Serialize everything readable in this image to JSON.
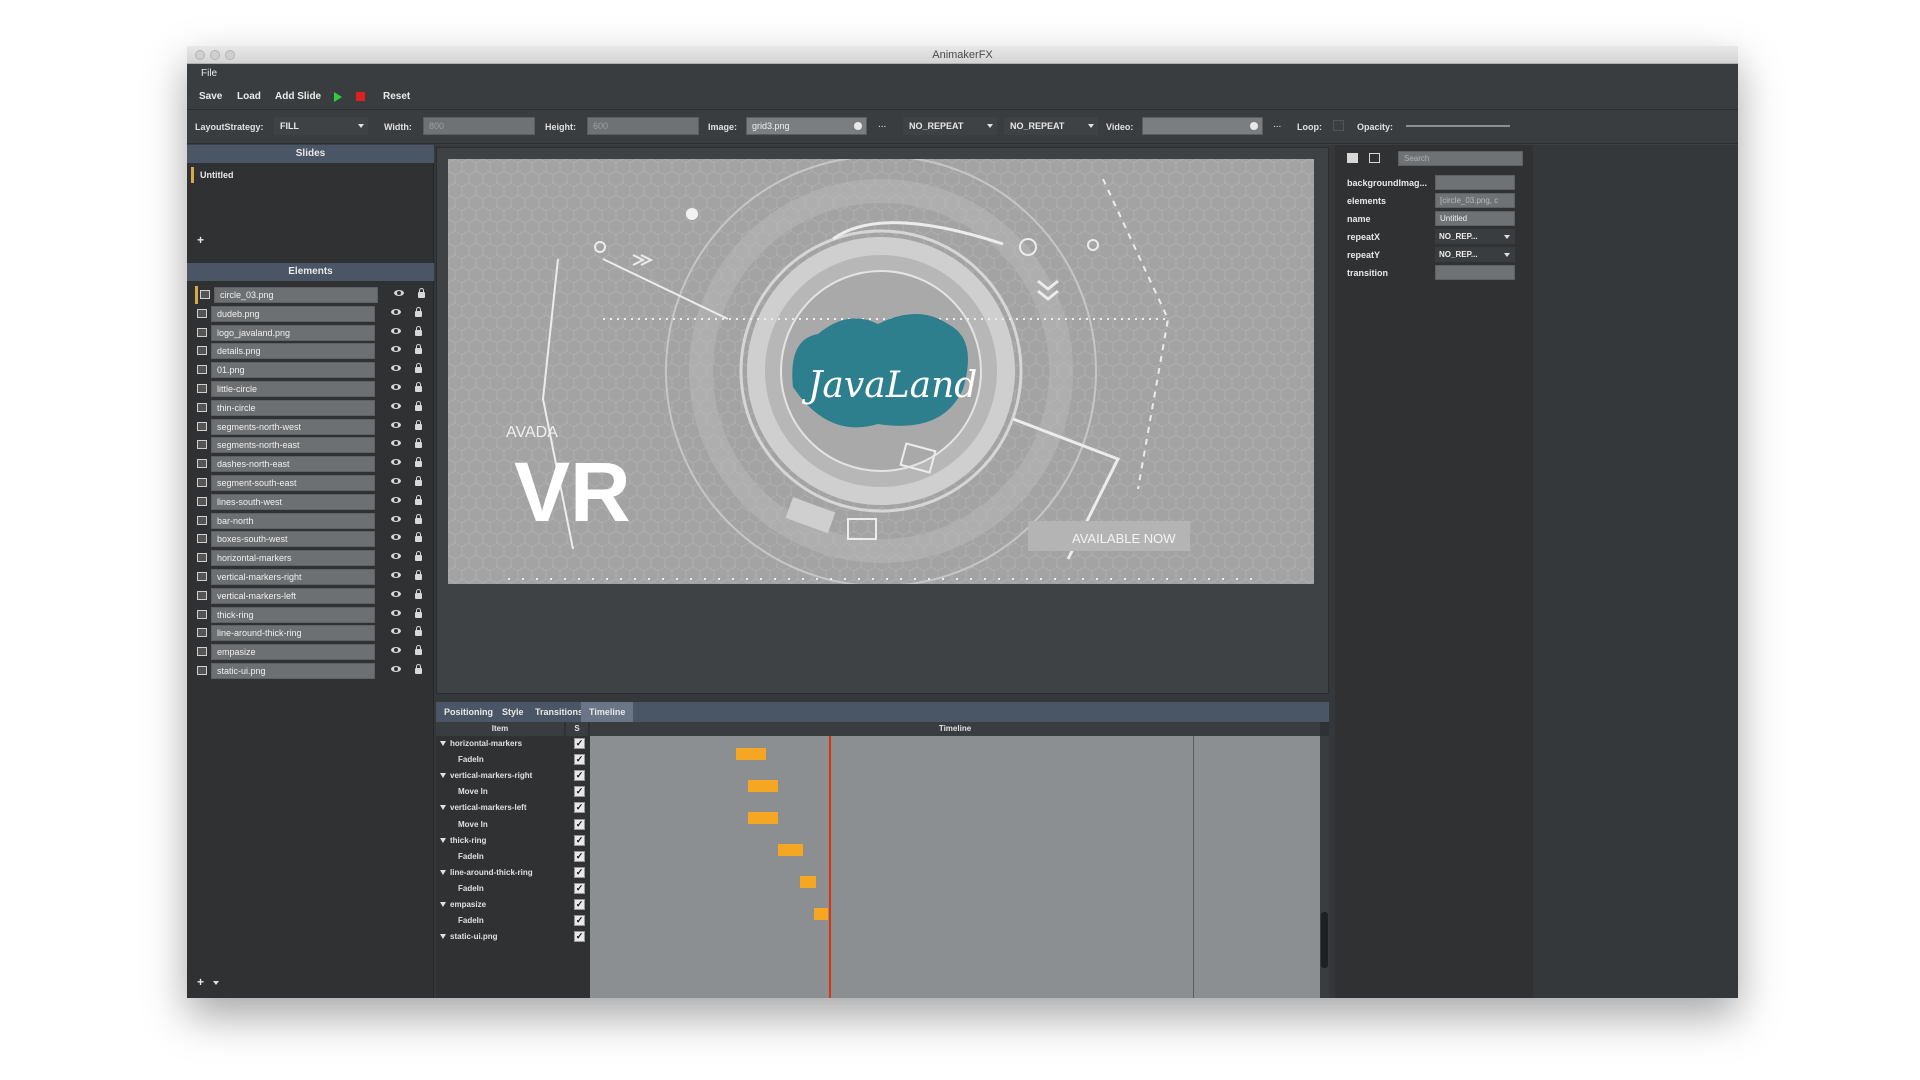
{
  "window": {
    "title": "AnimakerFX"
  },
  "menu": {
    "file": "File"
  },
  "toolbar": {
    "save": "Save",
    "load": "Load",
    "add_slide": "Add Slide",
    "reset": "Reset",
    "colors": {
      "play": "#2ecc40",
      "stop": "#e02020"
    }
  },
  "props_bar": {
    "layout_label": "LayoutStrategy:",
    "layout_value": "FILL",
    "width_label": "Width:",
    "width_value": "800",
    "height_label": "Height:",
    "height_value": "600",
    "image_label": "Image:",
    "image_value": "grid3.png",
    "image_more": "...",
    "repeat_x": "NO_REPEAT",
    "repeat_y": "NO_REPEAT",
    "video_label": "Video:",
    "video_value": "",
    "video_more": "...",
    "loop_label": "Loop:",
    "opacity_label": "Opacity:"
  },
  "slides_panel": {
    "header": "Slides",
    "items": [
      "Untitled"
    ],
    "add": "+"
  },
  "elements_panel": {
    "header": "Elements",
    "items": [
      "circle_03.png",
      "dudeb.png",
      "logo_javaland.png",
      "details.png",
      "01.png",
      "little-circle",
      "thin-circle",
      "segments-north-west",
      "segments-north-east",
      "dashes-north-east",
      "segment-south-east",
      "lines-south-west",
      "bar-north",
      "boxes-south-west",
      "horizontal-markers",
      "vertical-markers-right",
      "vertical-markers-left",
      "thick-ring",
      "line-around-thick-ring",
      "empasize",
      "static-ui.png"
    ],
    "add": "+"
  },
  "stage": {
    "logo_text": "JavaLand",
    "avada": "AVADA",
    "vr": "VR",
    "available": "AVAILABLE NOW",
    "colors": {
      "background": "#a3a3a3",
      "logo": "#2e7f8e"
    }
  },
  "tabs": [
    {
      "label": "Positioning"
    },
    {
      "label": "Style"
    },
    {
      "label": "Transitions"
    },
    {
      "label": "Timeline"
    }
  ],
  "timeline": {
    "col_item": "Item",
    "col_s": "S",
    "col_timeline": "Timeline",
    "rows": [
      {
        "label": "horizontal-markers",
        "group": true
      },
      {
        "label": "FadeIn",
        "group": false
      },
      {
        "label": "vertical-markers-right",
        "group": true
      },
      {
        "label": "Move In",
        "group": false
      },
      {
        "label": "vertical-markers-left",
        "group": true
      },
      {
        "label": "Move In",
        "group": false
      },
      {
        "label": "thick-ring",
        "group": true
      },
      {
        "label": "FadeIn",
        "group": false
      },
      {
        "label": "line-around-thick-ring",
        "group": true
      },
      {
        "label": "FadeIn",
        "group": false
      },
      {
        "label": "empasize",
        "group": true
      },
      {
        "label": "FadeIn",
        "group": false
      },
      {
        "label": "static-ui.png",
        "group": true
      }
    ],
    "colors": {
      "bar": "#f5a623",
      "playhead": "#e03010"
    }
  },
  "right_panel": {
    "search_placeholder": "Search",
    "props": [
      {
        "label": "backgroundImag...",
        "value": "",
        "kind": "field"
      },
      {
        "label": "elements",
        "value": "[circle_03.png, c",
        "kind": "field"
      },
      {
        "label": "name",
        "value": "Untitled",
        "kind": "field"
      },
      {
        "label": "repeatX",
        "value": "NO_REP...",
        "kind": "combo"
      },
      {
        "label": "repeatY",
        "value": "NO_REP...",
        "kind": "combo"
      },
      {
        "label": "transition",
        "value": "",
        "kind": "field"
      }
    ]
  }
}
